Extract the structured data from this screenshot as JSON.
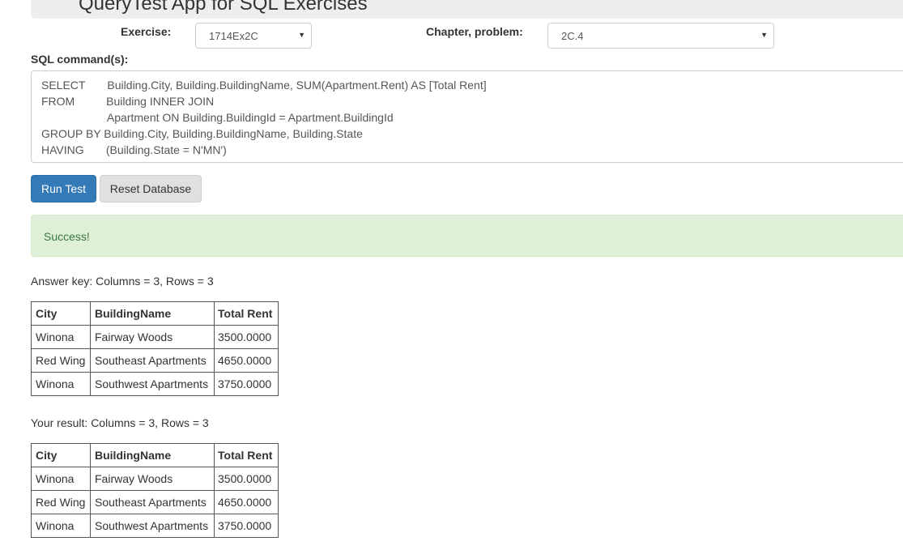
{
  "app": {
    "title": "QueryTest App for SQL Exercises"
  },
  "exercise": {
    "label": "Exercise:",
    "selected": "1714Ex2C"
  },
  "chapter": {
    "label": "Chapter, problem:",
    "selected": "2C.4"
  },
  "sql": {
    "label": "SQL command(s):",
    "lines": [
      "SELECT       Building.City, Building.BuildingName, SUM(Apartment.Rent) AS [Total Rent]",
      "FROM          Building INNER JOIN",
      "                     Apartment ON Building.BuildingId = Apartment.BuildingId",
      "GROUP BY Building.City, Building.BuildingName, Building.State",
      "HAVING       (Building.State = N'MN')"
    ]
  },
  "buttons": {
    "run_label": "Run Test",
    "reset_label": "Reset Database"
  },
  "alert": {
    "message": "Success!"
  },
  "answer_key": {
    "summary": "Answer key: Columns = 3, Rows = 3",
    "columns": [
      "City",
      "BuildingName",
      "Total Rent"
    ],
    "rows": [
      [
        "Winona",
        "Fairway Woods",
        "3500.0000"
      ],
      [
        "Red Wing",
        "Southeast Apartments",
        "4650.0000"
      ],
      [
        "Winona",
        "Southwest Apartments",
        "3750.0000"
      ]
    ]
  },
  "your_result": {
    "summary": "Your result: Columns = 3, Rows = 3",
    "columns": [
      "City",
      "BuildingName",
      "Total Rent"
    ],
    "rows": [
      [
        "Winona",
        "Fairway Woods",
        "3500.0000"
      ],
      [
        "Red Wing",
        "Southeast Apartments",
        "4650.0000"
      ],
      [
        "Winona",
        "Southwest Apartments",
        "3750.0000"
      ]
    ]
  },
  "icons": {
    "select_caret": "▼"
  },
  "colors": {
    "primary": "#337ab7",
    "success_bg": "#dff0d8",
    "success_text": "#3c763d"
  }
}
